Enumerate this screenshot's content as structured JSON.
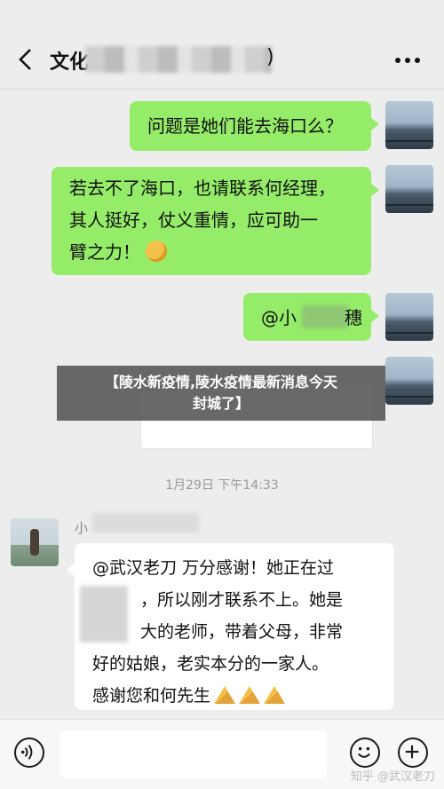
{
  "header": {
    "title": "文化",
    "title_suffix": ")"
  },
  "messages": [
    {
      "text": "问题是她们能去海口么？"
    },
    {
      "lines": [
        "若去不了海口，也请联系何经理，",
        "其人挺好，仗义重情，应可助一",
        "臂之力！"
      ]
    },
    {
      "mention_prefix": "@小",
      "mention_suffix": "穗"
    }
  ],
  "banner": {
    "line1": "【陵水新疫情,陵水疫情最新消息今天",
    "line2": "封城了】"
  },
  "timestamp": "1月29日 下午14:33",
  "incoming": {
    "sender": "小",
    "lines": [
      "@武汉老刀  万分感谢！她正在过",
      "，所以刚才联系不上。她是",
      "大的老师，带着父母，非常",
      "好的姑娘，老实本分的一家人。",
      "感谢您和何先生"
    ]
  },
  "watermark": "知乎 @武汉老刀",
  "icons": {
    "back": "back-icon",
    "more": "more-icon",
    "voice": "voice-icon",
    "emoji": "emoji-icon",
    "plus": "plus-icon"
  },
  "colors": {
    "self_bubble": "#95ec69",
    "other_bubble": "#ffffff",
    "background": "#ededed"
  }
}
